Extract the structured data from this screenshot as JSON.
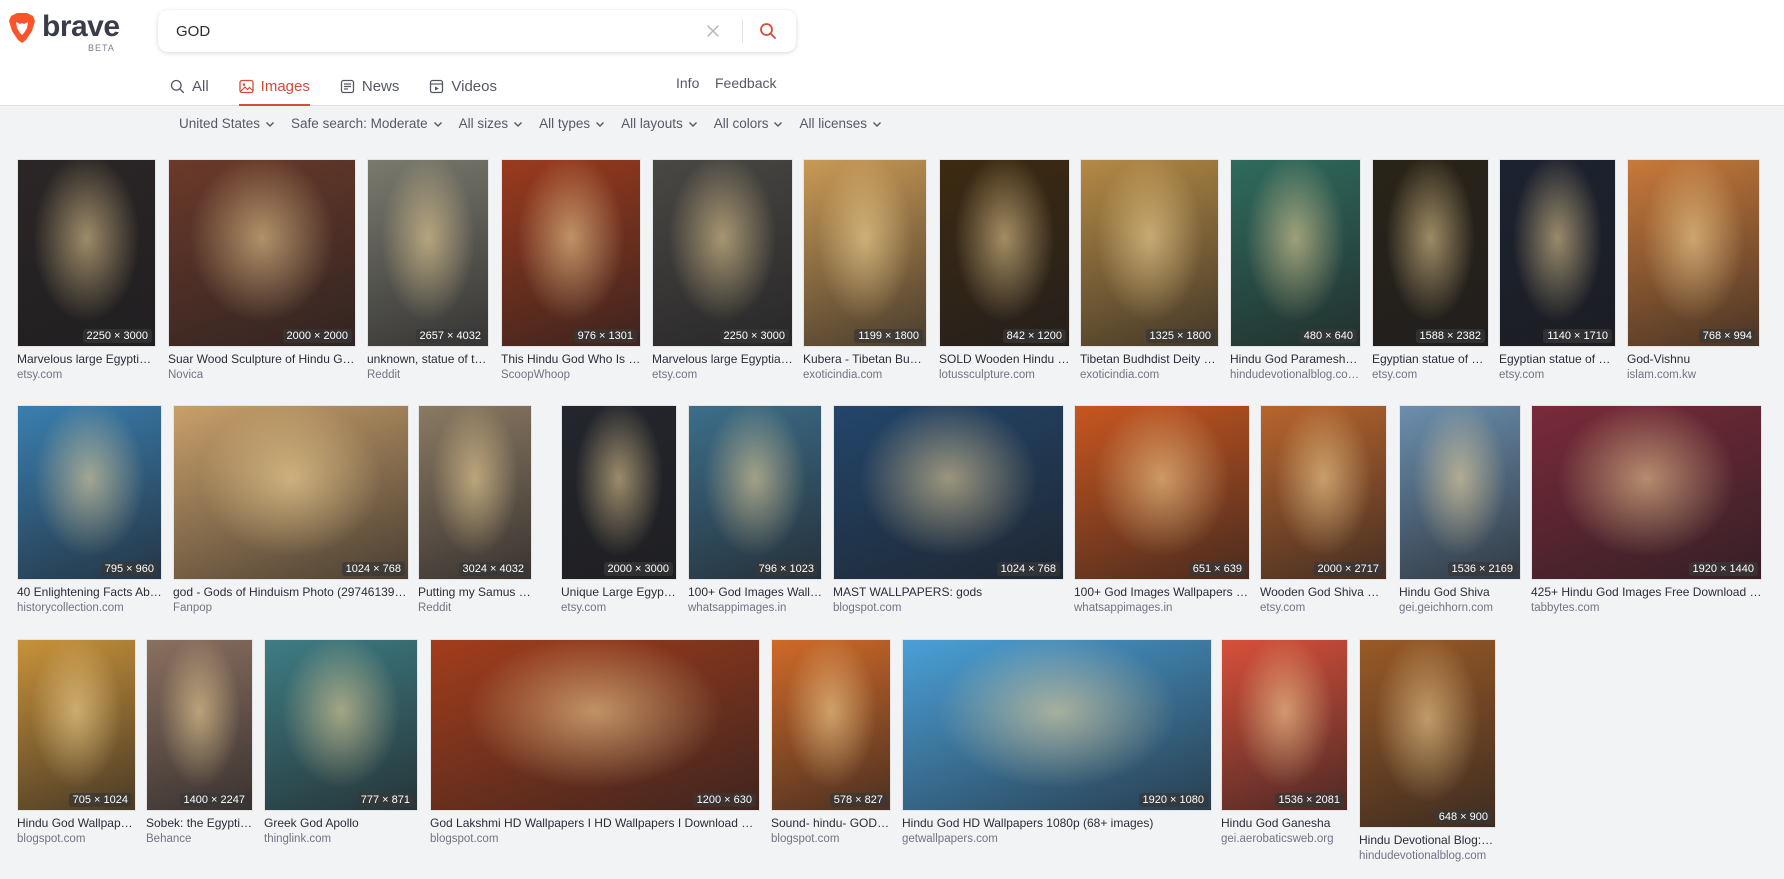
{
  "brand": {
    "name": "brave",
    "badge": "BETA",
    "accent": "#fb542b"
  },
  "search": {
    "query": "GOD"
  },
  "tabs": [
    {
      "label": "All",
      "icon": "search-icon"
    },
    {
      "label": "Images",
      "icon": "image-icon",
      "active": true
    },
    {
      "label": "News",
      "icon": "newspaper-icon"
    },
    {
      "label": "Videos",
      "icon": "video-icon"
    }
  ],
  "links": {
    "info": "Info",
    "feedback": "Feedback"
  },
  "filters": [
    {
      "label": "United States"
    },
    {
      "label": "Safe search: Moderate"
    },
    {
      "label": "All sizes"
    },
    {
      "label": "All types"
    },
    {
      "label": "All layouts"
    },
    {
      "label": "All colors"
    },
    {
      "label": "All licenses"
    }
  ],
  "results": [
    {
      "caption": "Marvelous large Egyptia…",
      "source": "etsy.com",
      "resolution": "2250 × 3000",
      "color": "#2b2626"
    },
    {
      "caption": "Suar Wood Sculpture of Hindu Go…",
      "source": "Novica",
      "resolution": "2000 × 2000",
      "color": "#6b3a2a"
    },
    {
      "caption": "unknown, statue of t…",
      "source": "Reddit",
      "resolution": "2657 × 4032",
      "color": "#7a7a6e"
    },
    {
      "caption": "This Hindu God Who Is S…",
      "source": "ScoopWhoop",
      "resolution": "976 × 1301",
      "color": "#9b3a1e"
    },
    {
      "caption": "Marvelous large Egyptia…",
      "source": "etsy.com",
      "resolution": "2250 × 3000",
      "color": "#4a4844"
    },
    {
      "caption": "Kubera - Tibetan Bud…",
      "source": "exoticindia.com",
      "resolution": "1199 × 1800",
      "color": "#c99a55"
    },
    {
      "caption": "SOLD Wooden Hindu G…",
      "source": "lotussculpture.com",
      "resolution": "842 × 1200",
      "color": "#3d2a12"
    },
    {
      "caption": "Tibetan Budhdist Deity …",
      "source": "exoticindia.com",
      "resolution": "1325 × 1800",
      "color": "#b48a45"
    },
    {
      "caption": "Hindu God Parameshw…",
      "source": "hindudevotionalblog.co…",
      "resolution": "480 × 640",
      "color": "#2f6b5e"
    },
    {
      "caption": "Egyptian statue of g…",
      "source": "etsy.com",
      "resolution": "1588 × 2382",
      "color": "#2a2418"
    },
    {
      "caption": "Egyptian statue of g…",
      "source": "etsy.com",
      "resolution": "1140 × 1710",
      "color": "#1c2230"
    },
    {
      "caption": "God-Vishnu",
      "source": "islam.com.kw",
      "resolution": "768 × 994",
      "color": "#c87a3a"
    },
    {
      "caption": "40 Enlightening Facts Ab…",
      "source": "historycollection.com",
      "resolution": "795 × 960",
      "color": "#3a7fb0"
    },
    {
      "caption": "god - Gods of Hinduism Photo (29746139) …",
      "source": "Fanpop",
      "resolution": "1024 × 768",
      "color": "#c9a06a"
    },
    {
      "caption": "Putting my Samus keyc…",
      "source": "Reddit",
      "resolution": "3024 × 4032",
      "color": "#8b7a63"
    },
    {
      "caption": "Unique Large Egypti…",
      "source": "etsy.com",
      "resolution": "2000 × 3000",
      "color": "#23262d"
    },
    {
      "caption": "100+ God Images Wallp…",
      "source": "whatsappimages.in",
      "resolution": "796 × 1023",
      "color": "#3c6e8a"
    },
    {
      "caption": "MAST WALLPAPERS: gods",
      "source": "blogspot.com",
      "resolution": "1024 × 768",
      "color": "#23466b"
    },
    {
      "caption": "100+ God Images Wallpapers D…",
      "source": "whatsappimages.in",
      "resolution": "651 × 639",
      "color": "#c8561f"
    },
    {
      "caption": "Wooden God Shiva Ph…",
      "source": "etsy.com",
      "resolution": "2000 × 2717",
      "color": "#b8652d"
    },
    {
      "caption": "Hindu God Shiva",
      "source": "gei.geichhorn.com",
      "resolution": "1536 × 2169",
      "color": "#6b8fae"
    },
    {
      "caption": "425+ Hindu God Images Free Download Fo…",
      "source": "tabbytes.com",
      "resolution": "1920 × 1440",
      "color": "#7a2a3a"
    },
    {
      "caption": "Hindu God Wallpape…",
      "source": "blogspot.com",
      "resolution": "705 × 1024",
      "color": "#c8923a"
    },
    {
      "caption": "Sobek: the Egypti…",
      "source": "Behance",
      "resolution": "1400 × 2247",
      "color": "#8a7060"
    },
    {
      "caption": "Greek God Apollo",
      "source": "thinglink.com",
      "resolution": "777 × 871",
      "color": "#3e7d84"
    },
    {
      "caption": "God Lakshmi HD Wallpapers I HD Wallpapers I Download Free…",
      "source": "blogspot.com",
      "resolution": "1200 × 630",
      "color": "#a33d1c"
    },
    {
      "caption": "Sound- hindu- GOD- …",
      "source": "blogspot.com",
      "resolution": "578 × 827",
      "color": "#d06a28"
    },
    {
      "caption": "Hindu God HD Wallpapers 1080p (68+ images)",
      "source": "getwallpapers.com",
      "resolution": "1920 × 1080",
      "color": "#4aa0d8"
    },
    {
      "caption": "Hindu God Ganesha",
      "source": "gei.aerobaticsweb.org",
      "resolution": "1536 × 2081",
      "color": "#d8503a"
    },
    {
      "caption": "Hindu Devotional Blog: …",
      "source": "hindudevotionalblog.com",
      "resolution": "648 × 900",
      "color": "#9a5a26"
    }
  ]
}
